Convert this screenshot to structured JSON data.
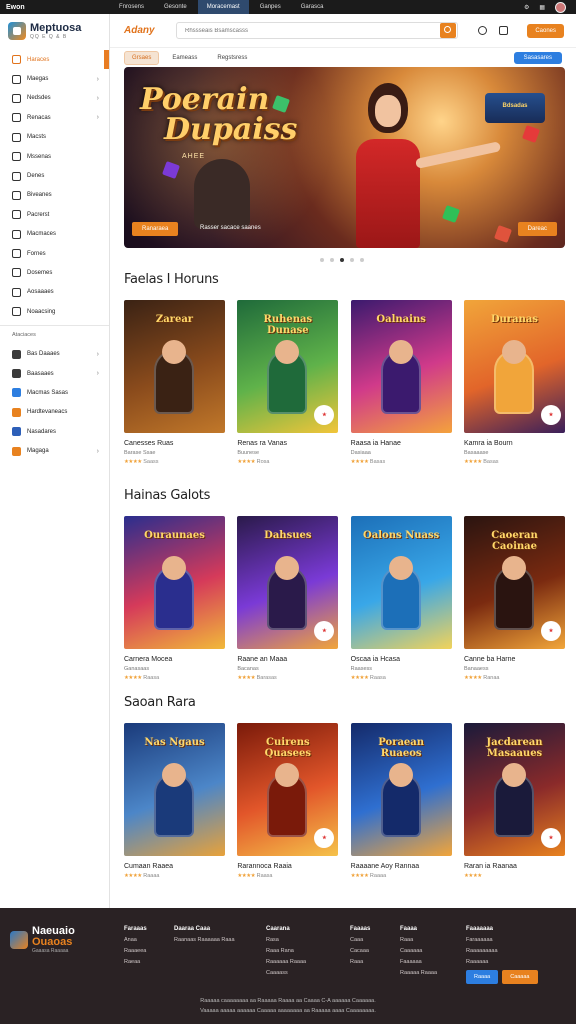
{
  "topbar": {
    "brand": "Ewon",
    "nav": [
      "Fnrosens",
      "Gesonte",
      "Moracemast",
      "Ganpes",
      "Garasca"
    ],
    "active_index": 2
  },
  "sidebar": {
    "logo_title": "Meptuosa",
    "logo_sub": "QQ E Q & B",
    "items": [
      {
        "label": "Haraces",
        "chev": false,
        "active": true
      },
      {
        "label": "Maegas",
        "chev": true
      },
      {
        "label": "Nedsdes",
        "chev": true
      },
      {
        "label": "Renacas",
        "chev": true
      },
      {
        "label": "Macsts",
        "chev": false
      },
      {
        "label": "Mssenas",
        "chev": false
      },
      {
        "label": "Denes",
        "chev": false
      },
      {
        "label": "Biveanes",
        "chev": false
      },
      {
        "label": "Pacrerst",
        "chev": false
      },
      {
        "label": "Macmaces",
        "chev": false
      },
      {
        "label": "Fornes",
        "chev": false
      },
      {
        "label": "Dosemes",
        "chev": false
      },
      {
        "label": "Aosaaaes",
        "chev": false
      },
      {
        "label": "Noaacsing",
        "chev": false
      }
    ],
    "section_label": "Ataciaces",
    "items2": [
      {
        "label": "Bas Daaaes",
        "chev": true,
        "color": "#3b3b3b"
      },
      {
        "label": "Baasaaes",
        "chev": true,
        "color": "#3b3b3b"
      },
      {
        "label": "Macmas Sasas",
        "chev": false,
        "color": "#2d7ee0"
      },
      {
        "label": "Hardtevaneacs",
        "chev": false,
        "color": "#e8821f"
      },
      {
        "label": "Nasadares",
        "chev": false,
        "color": "#2d5fb8"
      },
      {
        "label": "Magaga",
        "chev": true,
        "color": "#e8821f"
      }
    ]
  },
  "header": {
    "logo": "Adany",
    "search_placeholder": "Rhssseais Bsamscasss",
    "cta": "Caones"
  },
  "subnav": {
    "tabs": [
      "Grsaes",
      "Eameass",
      "Regstsress"
    ],
    "right_button": "Sasasares"
  },
  "hero": {
    "title_line1": "Poerain",
    "title_line2": "Dupaiss",
    "subtitle": "AHEE",
    "btn_left": "Ranaraea",
    "caption": "Rasser sacace saanes",
    "btn_right": "Dareac",
    "minicard": "Bdsadas"
  },
  "sections": [
    {
      "title": "Faelas I Horuns",
      "cards": [
        {
          "art": "Zarear",
          "name": "Canesses Ruas",
          "meta": "Barase Ssae",
          "rating": "Saass"
        },
        {
          "art": "Ruhenas Dunase",
          "name": "Renas ra Vanas",
          "meta": "Buunese",
          "rating": "Rosa"
        },
        {
          "art": "Oalnains",
          "name": "Raasa ia Hanae",
          "meta": "Dasiaaa",
          "rating": "Basas"
        },
        {
          "art": "Duranas",
          "name": "Kamra ia Bourn",
          "meta": "Basaaase",
          "rating": "Basas"
        }
      ]
    },
    {
      "title": "Hainas Galots",
      "cards": [
        {
          "art": "Ouraunaes",
          "name": "Carnera Mocea",
          "meta": "Ganasaas",
          "rating": "Raasa"
        },
        {
          "art": "Dahsues",
          "name": "Raane an Maaa",
          "meta": "Bacanas",
          "rating": "Barasas"
        },
        {
          "art": "Oalons Nuass",
          "name": "Oscaa ia Hcasa",
          "meta": "Raasess",
          "rating": "Raasa"
        },
        {
          "art": "Caoeran Caoinae",
          "name": "Canne ba Harne",
          "meta": "Banaaess",
          "rating": "Ranaa"
        }
      ]
    },
    {
      "title": "Saoan Rara",
      "cards": [
        {
          "art": "Nas Ngaus",
          "name": "Cumaan Raaea",
          "meta": "",
          "rating": "Raaaa"
        },
        {
          "art": "Cuirens Quasees",
          "name": "Rarannoca Raaia",
          "meta": "",
          "rating": "Raasa"
        },
        {
          "art": "Poraean Ruaeos",
          "name": "Raaaane Aoy Rannaa",
          "meta": "",
          "rating": "Raaaa"
        },
        {
          "art": "Jacdarean Masaaues",
          "name": "Raran ia Raanaa",
          "meta": "",
          "rating": ""
        }
      ]
    }
  ],
  "footer": {
    "logo_title": "Naeuaio",
    "logo_title2": "Ouaoas",
    "logo_sub": "Gaaasa Raaaaa",
    "col1": {
      "h": "Faraaas",
      "items": [
        "Anaa",
        "Raaaeea",
        "Raeaa"
      ]
    },
    "col2": {
      "h": "Daaraa Caaa",
      "items": [
        "Raanaas Raaaaaa Raaa"
      ]
    },
    "col3": {
      "h": "Caarana",
      "items": [
        "Rasa",
        "Raaa Rana",
        "Raaaaaa Raaaa",
        "Caaaass"
      ]
    },
    "col4": {
      "h": "Faaaas",
      "items": [
        "Caaa",
        "Cacaaa",
        "Raaa"
      ]
    },
    "col5": {
      "h": "Faaaa",
      "items": [
        "Raaa",
        "Caaaaaa",
        "Faaaaaa",
        "Raaaaa Raaaa"
      ]
    },
    "col6": {
      "h": "Faaaaaaa",
      "items": [
        "Faraaaaaa",
        "Raaaaaaaaa",
        "Raaaaaa"
      ]
    },
    "app1": "Raaaa",
    "app2": "Caaaaa",
    "copy1": "Raaaaa caaaaaaaa aa Raaaaa Raaaa aa Caaaa C-A aaaaaa Caaaaaa.",
    "copy2": "Vaaaaa aaaaa aaaaaa Caaaaa aaaaaaaa aa Raaaaa aaaa Caaaaaaaa."
  }
}
